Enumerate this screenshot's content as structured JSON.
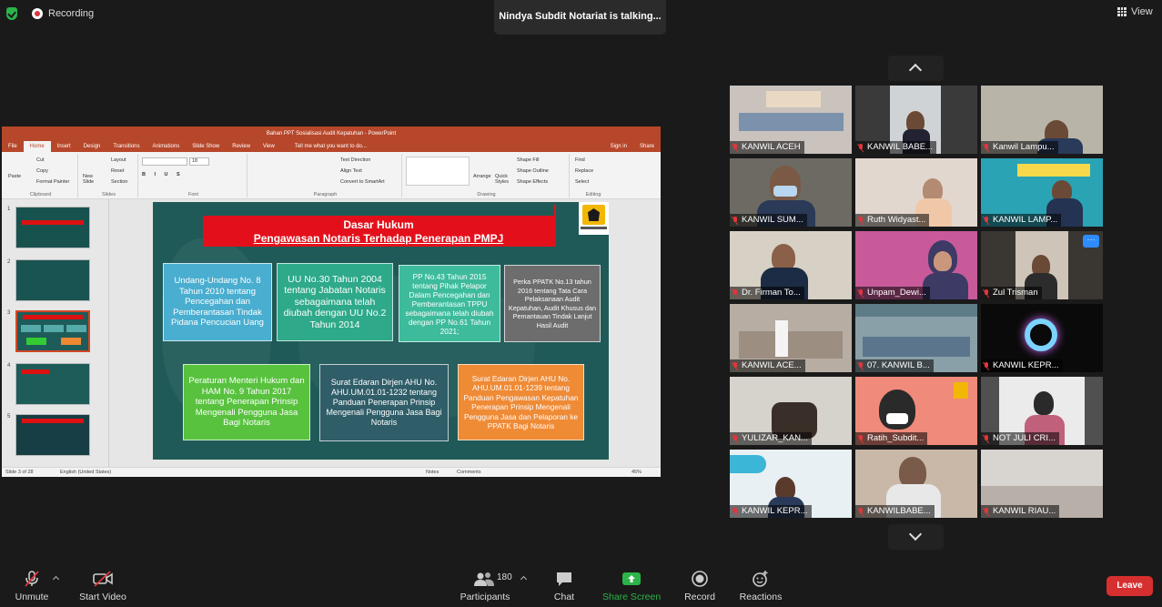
{
  "topbar": {
    "recording_label": "Recording",
    "talking_banner": "Nindya Subdit Notariat is talking...",
    "view_label": "View"
  },
  "powerpoint": {
    "title": "Bahan PPT Sosialisasi Audit Kepatuhan - PowerPoint",
    "menu": [
      "File",
      "Home",
      "Insert",
      "Design",
      "Transitions",
      "Animations",
      "Slide Show",
      "Review",
      "View"
    ],
    "tell_me": "Tell me what you want to do...",
    "sign_in": "Sign in",
    "share": "Share",
    "ribbon": {
      "paste": "Paste",
      "cut": "Cut",
      "copy": "Copy",
      "format_painter": "Format Painter",
      "clipboard": "Clipboard",
      "new_slide": "New Slide",
      "layout": "Layout",
      "reset": "Reset",
      "section": "Section",
      "slides": "Slides",
      "font_size": "18",
      "font": "Font",
      "text_direction": "Text Direction",
      "align_text": "Align Text",
      "convert_smartart": "Convert to SmartArt",
      "paragraph": "Paragraph",
      "arrange": "Arrange",
      "quick_styles": "Quick Styles",
      "shape_fill": "Shape Fill",
      "shape_outline": "Shape Outline",
      "shape_effects": "Shape Effects",
      "drawing": "Drawing",
      "find": "Find",
      "replace": "Replace",
      "select": "Select",
      "editing": "Editing"
    },
    "thumbnail_numbers": [
      "1",
      "2",
      "3",
      "4",
      "5"
    ],
    "status": {
      "slide_info": "Slide 3 of 28",
      "language": "English (United States)",
      "notes": "Notes",
      "comments": "Comments",
      "zoom": "45%"
    }
  },
  "slide": {
    "title_line1": "Dasar Hukum",
    "title_line2": "Pengawasan Notaris Terhadap Penerapan PMPJ",
    "boxes": [
      "Undang-Undang No. 8 Tahun 2010 tentang Pencegahan dan Pemberantasan Tindak Pidana Pencucian Uang",
      "UU No.30 Tahun 2004 tentang Jabatan Notaris sebagaimana telah diubah dengan UU No.2 Tahun 2014",
      "PP No.43 Tahun 2015 tentang Pihak Pelapor Dalam Pencegahan dan Pemberantasan TPPU sebagaimana telah diubah dengan PP No.61 Tahun 2021;",
      "Perka PPATK No.13 tahun 2016 tentang Tata Cara Pelaksanaan Audit Kepatuhan, Audit Khusus dan Pemantauan Tindak Lanjut Hasil Audit",
      "Peraturan Menteri Hukum dan HAM No. 9 Tahun 2017 tentang Penerapan Prinsip Mengenali Pengguna Jasa Bagi Notaris",
      "Surat Edaran Dirjen AHU No. AHU.UM.01.01-1232 tentang Panduan Penerapan Prinsip Mengenali Pengguna Jasa Bagi Notaris",
      "Surat Edaran Dirjen AHU No. AHU.UM.01.01-1239 tentang Panduan Pengawasan Kepatuhan Penerapan Prinsip Mengenali Pengguna Jasa dan Pelaporan ke PPATK Bagi Notaris"
    ]
  },
  "participants": [
    {
      "name": "KANWIL ACEH",
      "bg": "#c9c2bd"
    },
    {
      "name": "KANWIL BABE...",
      "bg": "#3a3a3a"
    },
    {
      "name": "Kanwil Lampu...",
      "bg": "#b8b4a8"
    },
    {
      "name": "KANWIL SUM...",
      "bg": "#6c6a62"
    },
    {
      "name": "Ruth Widyast...",
      "bg": "#e2d7cf"
    },
    {
      "name": "KANWIL LAMP...",
      "bg": "#2aa3b5"
    },
    {
      "name": "Dr. Firman To...",
      "bg": "#d7d0c4"
    },
    {
      "name": "Unpam_Dewi...",
      "bg": "#c85a9a"
    },
    {
      "name": "Zul Trisman",
      "bg": "#3a3632"
    },
    {
      "name": "KANWIL ACE...",
      "bg": "#b7ada2"
    },
    {
      "name": "07. KANWIL B...",
      "bg": "#8aa0a8"
    },
    {
      "name": "KANWIL KEPR...",
      "bg": "#0a0a0a"
    },
    {
      "name": "YULIZAR_KAN...",
      "bg": "#d6d2cc"
    },
    {
      "name": "Ratih_Subdit...",
      "bg": "#f08a7a"
    },
    {
      "name": "NOT JULI CRI...",
      "bg": "#c8c8c8"
    },
    {
      "name": "KANWIL KEPR...",
      "bg": "#e8f0f4"
    },
    {
      "name": "KANWILBABE...",
      "bg": "#c9b8a8"
    },
    {
      "name": "KANWIL RIAU...",
      "bg": "#d8d4cf"
    }
  ],
  "toolbar": {
    "unmute": "Unmute",
    "start_video": "Start Video",
    "participants": "Participants",
    "participant_count": "180",
    "chat": "Chat",
    "share_screen": "Share Screen",
    "record": "Record",
    "reactions": "Reactions",
    "leave": "Leave"
  }
}
